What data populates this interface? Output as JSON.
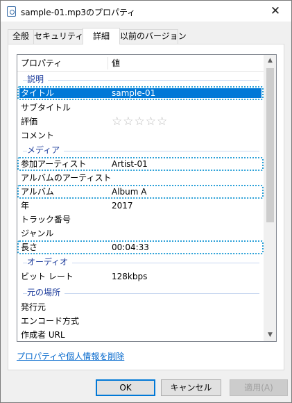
{
  "window": {
    "title": "sample-01.mp3のプロパティ",
    "close_glyph": "✕"
  },
  "tabs": [
    {
      "label": "全般"
    },
    {
      "label": "セキュリティ"
    },
    {
      "label": "詳細"
    },
    {
      "label": "以前のバージョン"
    }
  ],
  "active_tab": "詳細",
  "list": {
    "header": {
      "property": "プロパティ",
      "value": "値"
    },
    "groups": {
      "description": "説明",
      "media": "メディア",
      "audio": "オーディオ",
      "origin": "元の場所"
    },
    "rows": {
      "title": {
        "name": "タイトル",
        "value": "sample-01"
      },
      "subtitle": {
        "name": "サブタイトル",
        "value": ""
      },
      "rating": {
        "name": "評価",
        "value": "☆☆☆☆☆"
      },
      "comment": {
        "name": "コメント",
        "value": ""
      },
      "artist": {
        "name": "参加アーティスト",
        "value": "Artist-01"
      },
      "album_artist": {
        "name": "アルバムのアーティスト",
        "value": ""
      },
      "album": {
        "name": "アルバム",
        "value": "Album A"
      },
      "year": {
        "name": "年",
        "value": "2017"
      },
      "track": {
        "name": "トラック番号",
        "value": ""
      },
      "genre": {
        "name": "ジャンル",
        "value": ""
      },
      "length": {
        "name": "長さ",
        "value": "00:04:33"
      },
      "bitrate": {
        "name": "ビット レート",
        "value": "128kbps"
      },
      "publisher": {
        "name": "発行元",
        "value": ""
      },
      "encoded_by": {
        "name": "エンコード方式",
        "value": ""
      },
      "author_url": {
        "name": "作成者 URL",
        "value": ""
      }
    }
  },
  "remove_link": "プロパティや個人情報を削除",
  "buttons": {
    "ok": "OK",
    "cancel": "キャンセル",
    "apply": "適用(A)"
  },
  "colors": {
    "selection": "#0078d7",
    "focus_outline": "#2aa0d8",
    "group_text": "#1e3d9c",
    "link": "#0066cc"
  },
  "icons": {
    "window": "mp3-file-icon",
    "scroll_up": "chevron-up-icon",
    "scroll_down": "chevron-down-icon"
  }
}
